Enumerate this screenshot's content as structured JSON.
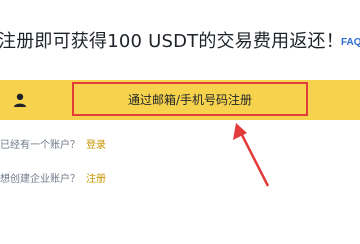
{
  "header": {
    "headline": "注册即可获得100 USDT的交易费用返还！",
    "faq_label": "FAQ"
  },
  "signup": {
    "button_label": "通过邮箱/手机号码注册",
    "icon": "user-icon"
  },
  "links": {
    "have_account_text": "已经有一个账户？",
    "login_label": "登录",
    "enterprise_text": "想创建企业账户？",
    "register_label": "注册"
  },
  "colors": {
    "bar_background": "#f7d34d",
    "highlight_border": "#e33a3a",
    "link_color": "#c99400",
    "faq_color": "#2d6ad6"
  }
}
